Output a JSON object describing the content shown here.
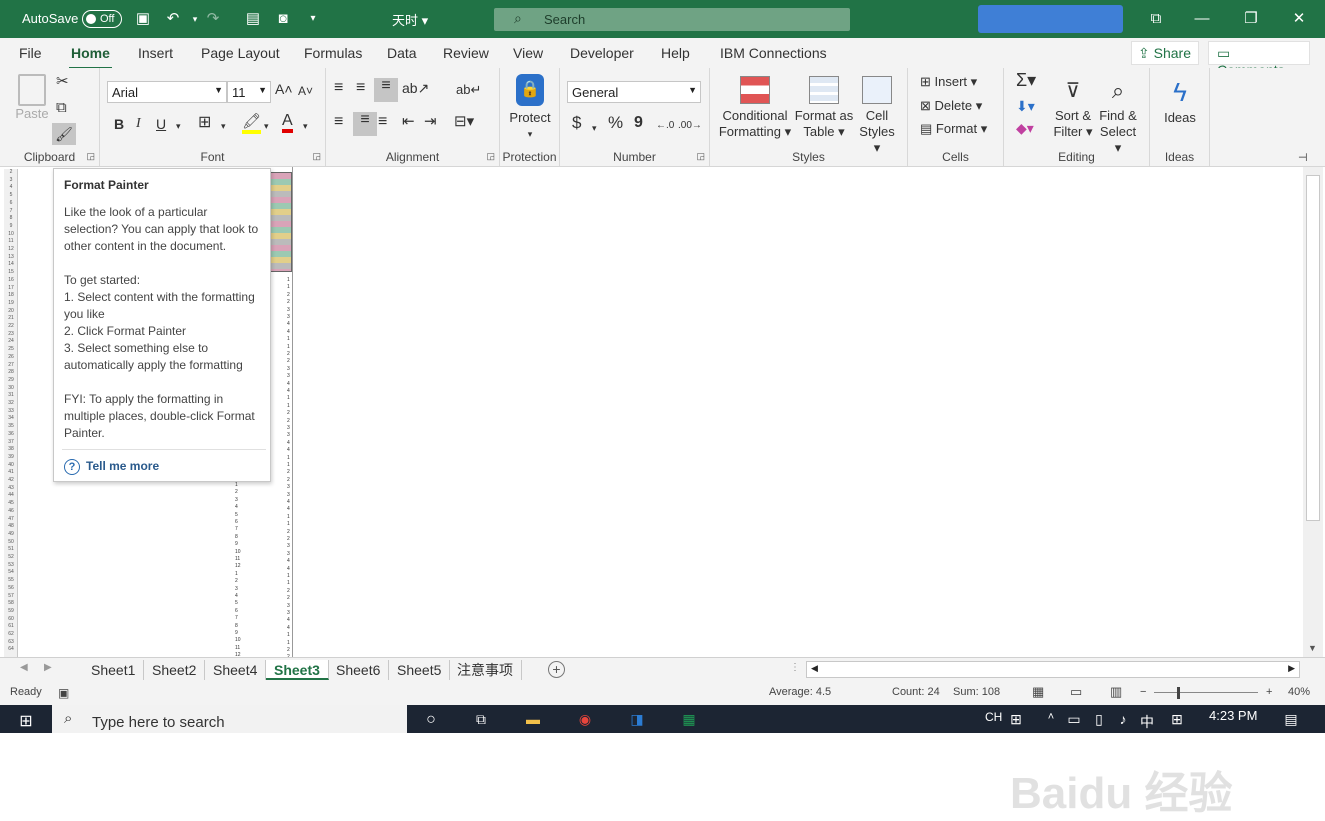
{
  "titlebar": {
    "autosave_label": "AutoSave",
    "autosave_state": "Off",
    "doc_title": "天时 ▾",
    "search_label": "Search"
  },
  "menu": {
    "tabs": [
      "File",
      "Home",
      "Insert",
      "Page Layout",
      "Formulas",
      "Data",
      "Review",
      "View",
      "Developer",
      "Help",
      "IBM Connections"
    ],
    "active": "Home",
    "share": "Share",
    "comments": "Comments"
  },
  "ribbon": {
    "clipboard": {
      "label": "Clipboard",
      "paste": "Paste"
    },
    "font": {
      "label": "Font",
      "name": "Arial",
      "size": "11",
      "bold": "B",
      "italic": "I",
      "underline": "U"
    },
    "alignment": {
      "label": "Alignment"
    },
    "protection": {
      "label": "Protection",
      "protect": "Protect"
    },
    "number": {
      "label": "Number",
      "format": "General",
      "currency": "$",
      "percent": "%",
      "comma": "9"
    },
    "styles": {
      "label": "Styles",
      "conditional": "Conditional",
      "conditional2": "Formatting",
      "format_as": "Format as",
      "format_as2": "Table",
      "cell": "Cell",
      "cell2": "Styles"
    },
    "cells": {
      "label": "Cells",
      "insert": "Insert",
      "delete": "Delete",
      "format": "Format"
    },
    "editing": {
      "label": "Editing",
      "sort": "Sort &",
      "sort2": "Filter",
      "find": "Find &",
      "find2": "Select"
    },
    "ideas": {
      "label": "Ideas",
      "ideas": "Ideas"
    }
  },
  "tooltip": {
    "title": "Format Painter",
    "p1": "Like the look of a particular selection? You can apply that look to other content in the document.",
    "p2a": "To get started:",
    "p2b": "1. Select content with the formatting you like",
    "p2c": "2. Click Format Painter",
    "p2d": "3. Select something else to automatically apply the formatting",
    "p3": "FYI: To apply the formatting in multiple places, double-click Format Painter.",
    "more": "Tell me more"
  },
  "sheets": {
    "tabs": [
      "Sheet1",
      "Sheet2",
      "Sheet4",
      "Sheet3",
      "Sheet6",
      "Sheet5",
      "注意事项"
    ],
    "active": "Sheet3"
  },
  "status": {
    "ready": "Ready",
    "average": "Average: 4.5",
    "count": "Count: 24",
    "sum": "Sum: 108",
    "zoom": "40%"
  },
  "taskbar": {
    "search": "Type here to search",
    "lang": "CH",
    "ime": "中",
    "time": "4:23 PM"
  },
  "colors": {
    "excel_green": "#217346",
    "accent_blue": "#3f7fd6"
  }
}
